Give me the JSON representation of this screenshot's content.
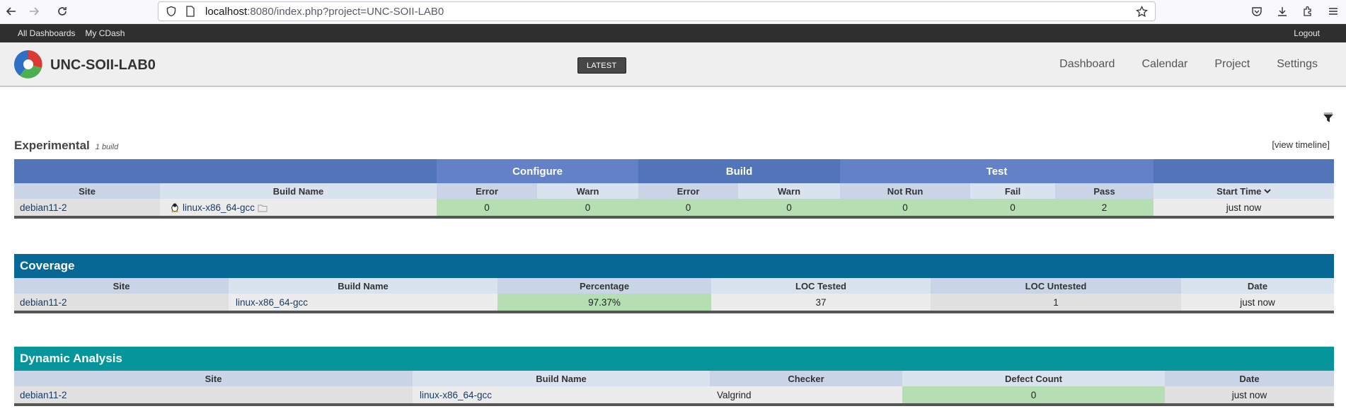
{
  "browser": {
    "url_host": "localhost",
    "url_rest": ":8080/index.php?project=UNC-SOII-LAB0"
  },
  "topbar": {
    "all_dashboards": "All Dashboards",
    "my_cdash": "My CDash",
    "logout": "Logout"
  },
  "header": {
    "project_name": "UNC-SOII-LAB0",
    "latest_label": "LATEST",
    "nav": [
      "Dashboard",
      "Calendar",
      "Project",
      "Settings"
    ]
  },
  "experimental": {
    "title": "Experimental",
    "count": "1 build",
    "timeline_link": "[view timeline]",
    "groups": {
      "configure": "Configure",
      "build": "Build",
      "test": "Test"
    },
    "columns": [
      "Site",
      "Build Name",
      "Error",
      "Warn",
      "Error",
      "Warn",
      "Not Run",
      "Fail",
      "Pass",
      "Start Time"
    ],
    "row": {
      "site": "debian11-2",
      "build_name": "linux-x86_64-gcc",
      "configure_error": "0",
      "configure_warn": "0",
      "build_error": "0",
      "build_warn": "0",
      "test_not_run": "0",
      "test_fail": "0",
      "test_pass": "2",
      "start_time": "just now"
    }
  },
  "coverage": {
    "title": "Coverage",
    "columns": [
      "Site",
      "Build Name",
      "Percentage",
      "LOC Tested",
      "LOC Untested",
      "Date"
    ],
    "row": {
      "site": "debian11-2",
      "build_name": "linux-x86_64-gcc",
      "percentage": "97.37%",
      "loc_tested": "37",
      "loc_untested": "1",
      "date": "just now"
    }
  },
  "dynamic_analysis": {
    "title": "Dynamic Analysis",
    "columns": [
      "Site",
      "Build Name",
      "Checker",
      "Defect Count",
      "Date"
    ],
    "row": {
      "site": "debian11-2",
      "build_name": "linux-x86_64-gcc",
      "checker": "Valgrind",
      "defect_count": "0",
      "date": "just now"
    }
  },
  "colors": {
    "group_header_blue": "#5274b8",
    "coverage_header": "#076895",
    "dynamic_header": "#06959a",
    "ok_green": "#b5dfb2"
  }
}
